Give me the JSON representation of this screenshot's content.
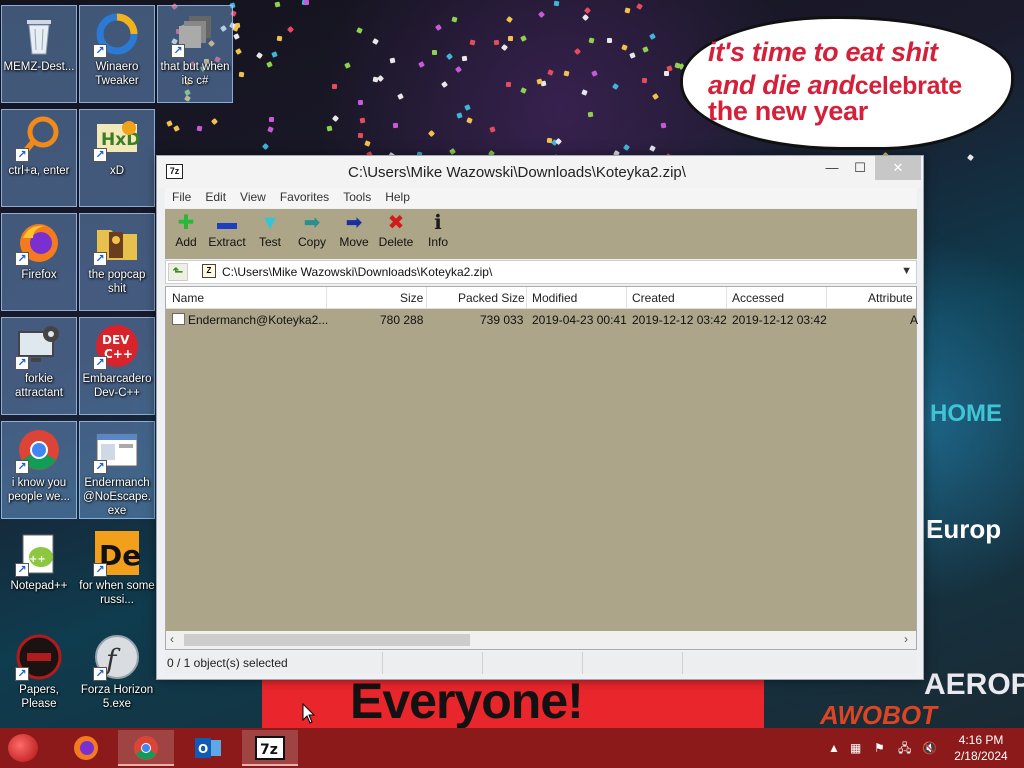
{
  "wallpaper": {
    "speech_bubble": {
      "line1": "it's time to eat shit",
      "line2a": "and die and",
      "line2b": "celebrate",
      "line3": "the new year"
    },
    "banner_text": "Everyone!",
    "sign_home": "HOME",
    "sign_europ": "Europ",
    "sign_aeropost": "AEROPOS",
    "graffiti": "AWOBOT"
  },
  "desktop": {
    "icons": [
      {
        "label": "MEMZ-Dest...",
        "icon": "recycle-bin-icon"
      },
      {
        "label": "Winaero Tweaker",
        "icon": "winaero-icon"
      },
      {
        "label": "that but when its c#",
        "icon": "stack-icon"
      },
      {
        "label": "ctrl+a, enter",
        "icon": "magnifier-icon"
      },
      {
        "label": "xD",
        "icon": "hxd-icon"
      },
      {
        "label": "Firefox",
        "icon": "firefox-icon"
      },
      {
        "label": "the popcap shit",
        "icon": "popcap-folder-icon"
      },
      {
        "label": "forkie attractant",
        "icon": "monitor-gear-icon"
      },
      {
        "label": "Embarcadero Dev-C++",
        "icon": "devcpp-icon"
      },
      {
        "label": "i know you people we...",
        "icon": "chrome-icon"
      },
      {
        "label": "Endermanch @NoEscape.exe",
        "icon": "window-app-icon"
      },
      {
        "label": "Notepad++",
        "icon": "notepadpp-icon"
      },
      {
        "label": "for when some russi...",
        "icon": "de-icon"
      },
      {
        "label": "Papers, Please",
        "icon": "papers-please-icon"
      },
      {
        "label": "Forza Horizon 5.exe",
        "icon": "flash-icon"
      }
    ]
  },
  "window": {
    "app_icon": "7z",
    "title": "C:\\Users\\Mike Wazowski\\Downloads\\Koteyka2.zip\\",
    "controls": {
      "minimize": "—",
      "maximize": "☐",
      "close": "✕"
    },
    "menu": [
      "File",
      "Edit",
      "View",
      "Favorites",
      "Tools",
      "Help"
    ],
    "toolbar": [
      {
        "label": "Add",
        "icon": "add-icon",
        "glyph": "✚",
        "color": "#27b83a"
      },
      {
        "label": "Extract",
        "icon": "extract-icon",
        "glyph": "▬",
        "color": "#1b3fbf"
      },
      {
        "label": "Test",
        "icon": "test-icon",
        "glyph": "▼",
        "color": "#33c6d1"
      },
      {
        "label": "Copy",
        "icon": "copy-icon",
        "glyph": "➡",
        "color": "#2a8f8f"
      },
      {
        "label": "Move",
        "icon": "move-icon",
        "glyph": "➡",
        "color": "#1b2f9f"
      },
      {
        "label": "Delete",
        "icon": "delete-icon",
        "glyph": "✖",
        "color": "#d21a1a"
      },
      {
        "label": "Info",
        "icon": "info-icon",
        "glyph": "ℹ",
        "color": "#1b1b1b"
      }
    ],
    "address": {
      "path": "C:\\Users\\Mike Wazowski\\Downloads\\Koteyka2.zip\\"
    },
    "columns": [
      "Name",
      "Size",
      "Packed Size",
      "Modified",
      "Created",
      "Accessed",
      "Attribute"
    ],
    "files": [
      {
        "name": "Endermanch@Koteyka2...",
        "size": "780 288",
        "packed": "739 033",
        "modified": "2019-04-23 00:41",
        "created": "2019-12-12 03:42",
        "accessed": "2019-12-12 03:42",
        "attr": "A"
      }
    ],
    "status": {
      "selection": "0 / 1 object(s) selected"
    }
  },
  "taskbar": {
    "apps": [
      "Firefox",
      "Google Chrome",
      "Outlook",
      "7-Zip"
    ],
    "clock": {
      "time": "4:16 PM",
      "date": "2/18/2024"
    }
  },
  "colors": {
    "taskbar": "#8c1a1a",
    "toolbar_bg": "#aca588",
    "list_bg": "#aca58a",
    "banner": "#e9262c",
    "bubble_text": "#d5203a"
  }
}
